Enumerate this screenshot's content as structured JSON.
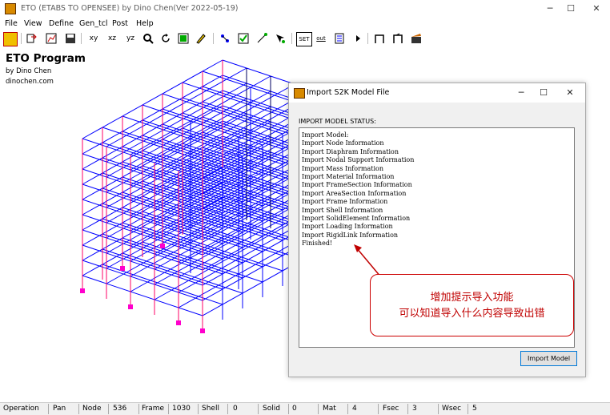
{
  "window": {
    "title": "ETO (ETABS TO OPENSEE) by Dino Chen(Ver 2022-05-19)",
    "minimize": "─",
    "maximize": "☐",
    "close": "✕"
  },
  "menu": [
    "File",
    "View",
    "Define",
    "Gen_tcl",
    "Post",
    "Help"
  ],
  "toolbar": {
    "xy": "xy",
    "xz": "xz",
    "yz": "yz",
    "set": "SET",
    "out": "out"
  },
  "program": {
    "title": "ETO Program",
    "author": "by Dino Chen",
    "site": "dinochen.com"
  },
  "dialog": {
    "title": "Import S2K Model File",
    "status_label": "IMPORT MODEL STATUS:",
    "status_lines": [
      "Import Model:",
      "Import Node Information",
      "Import Diaphram Information",
      "Import Nodal Support Information",
      "Import Mass Information",
      "Import Material Information",
      "Import FrameSection Information",
      "Import AreaSection Information",
      "Import Frame Information",
      "Import Shell Information",
      "Import SolidElement Information",
      "Import Loading Information",
      "Import RigidLink Information",
      "Finished!"
    ],
    "import_button": "Import Model"
  },
  "annotation": {
    "line1": "增加提示导入功能",
    "line2": "可以知道导入什么内容导致出错"
  },
  "statusbar": {
    "operation_label": "Operation",
    "operation_value": "Pan",
    "node_label": "Node",
    "node_value": "536",
    "frame_label": "Frame",
    "frame_value": "1030",
    "shell_label": "Shell",
    "shell_value": "0",
    "solid_label": "Solid",
    "solid_value": "0",
    "mat_label": "Mat",
    "mat_value": "4",
    "fsec_label": "Fsec",
    "fsec_value": "3",
    "wsec_label": "Wsec",
    "wsec_value": "5"
  },
  "colors": {
    "beam": "#0000ff",
    "column": "#ff0066",
    "support": "#ff00cc",
    "annotation": "#c00000"
  }
}
